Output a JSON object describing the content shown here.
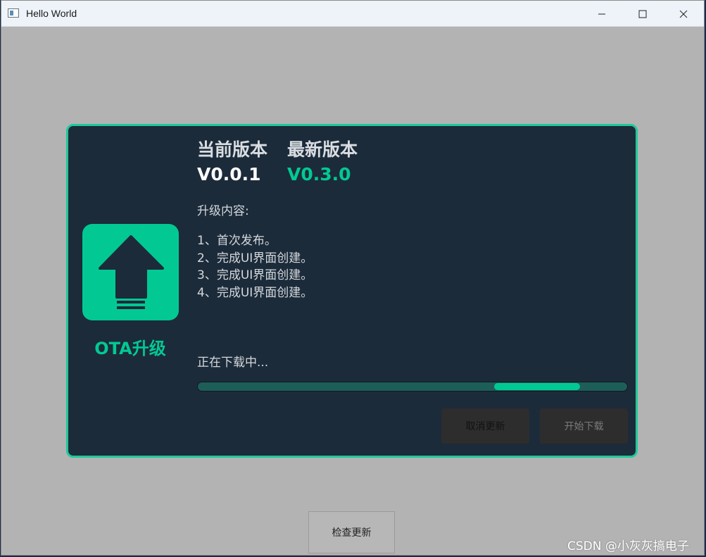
{
  "window": {
    "title": "Hello World"
  },
  "dialog": {
    "ota_label": "OTA升级",
    "current_version_header": "当前版本",
    "latest_version_header": "最新版本",
    "current_version": "V0.0.1",
    "latest_version": "V0.3.0",
    "content_title": "升级内容:",
    "notes": [
      "1、首次发布。",
      "2、完成UI界面创建。",
      "3、完成UI界面创建。",
      "4、完成UI界面创建。"
    ],
    "status_text": "正在下载中...",
    "progress": {
      "start_fraction": 0.69,
      "end_fraction": 0.89
    },
    "cancel_label": "取消更新",
    "start_label": "开始下载"
  },
  "check_button_label": "检查更新",
  "watermark": "CSDN @小灰灰搞电子",
  "colors": {
    "accent": "#02c993",
    "panel": "#1c2b3a",
    "background": "#b3b3b3"
  },
  "icons": [
    "app-window-icon",
    "minimize-icon",
    "maximize-icon",
    "close-icon",
    "upload-arrow-icon"
  ]
}
